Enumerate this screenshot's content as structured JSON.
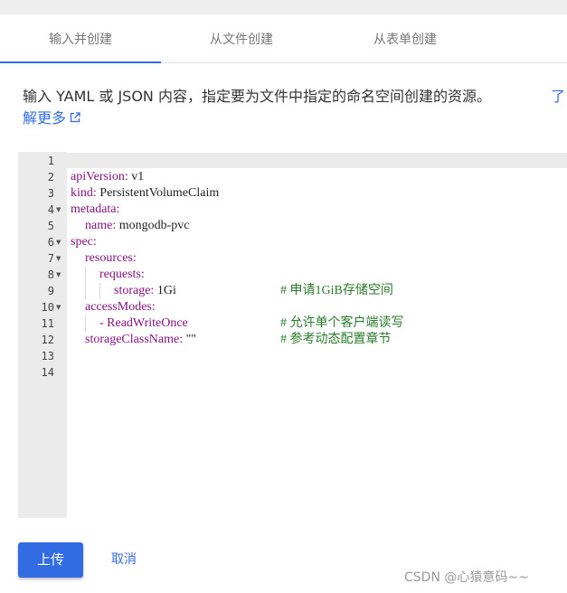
{
  "tabs": [
    {
      "label": "输入并创建",
      "active": true
    },
    {
      "label": "从文件创建",
      "active": false
    },
    {
      "label": "从表单创建",
      "active": false
    }
  ],
  "description": {
    "text": "输入 YAML 或 JSON 内容，指定要为文件中指定的命名空间创建的资源。",
    "link_part1": "了",
    "link_part2": "解更多"
  },
  "editor": {
    "line_numbers": [
      "1",
      "2",
      "3",
      "4",
      "5",
      "6",
      "7",
      "8",
      "9",
      "10",
      "11",
      "12",
      "13",
      "14"
    ],
    "lines": [
      {
        "key": "",
        "val": "",
        "comment": ""
      },
      {
        "key": "apiVersion:",
        "val": " v1",
        "comment": ""
      },
      {
        "key": "kind:",
        "val": " PersistentVolumeClaim",
        "comment": ""
      },
      {
        "key": "metadata:",
        "val": "",
        "comment": ""
      },
      {
        "key": "name:",
        "val": " mongodb-pvc",
        "comment": ""
      },
      {
        "key": "spec:",
        "val": "",
        "comment": ""
      },
      {
        "key": "resources:",
        "val": "",
        "comment": ""
      },
      {
        "key": "requests:",
        "val": "",
        "comment": ""
      },
      {
        "key": "storage:",
        "val": " 1Gi",
        "comment": "# 申请1GiB存储空间"
      },
      {
        "key": "accessModes:",
        "val": "",
        "comment": ""
      },
      {
        "key": "- ReadWriteOnce",
        "val": "",
        "comment": "# 允许单个客户端读写"
      },
      {
        "key": "storageClassName:",
        "val": " \"\"",
        "comment": "# 参考动态配置章节"
      },
      {
        "key": "",
        "val": "",
        "comment": ""
      },
      {
        "key": "",
        "val": "",
        "comment": ""
      }
    ]
  },
  "actions": {
    "upload_label": "上传",
    "cancel_label": "取消"
  },
  "watermark": "CSDN @心猿意码~~",
  "colors": {
    "accent": "#326ce5",
    "gutter": "#ebebeb",
    "comment": "#2a7a2a",
    "key": "#881280"
  }
}
